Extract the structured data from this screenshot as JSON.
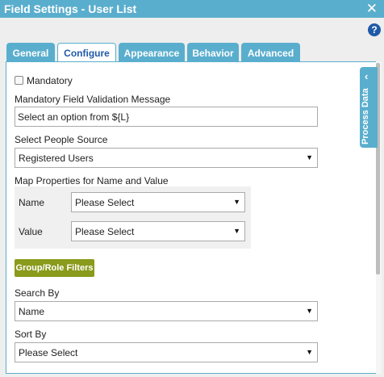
{
  "window": {
    "title": "Field Settings - User List",
    "close_glyph": "✕",
    "help_glyph": "?"
  },
  "tabs": [
    {
      "label": "General",
      "active": false
    },
    {
      "label": "Configure",
      "active": true
    },
    {
      "label": "Appearance",
      "active": false
    },
    {
      "label": "Behavior",
      "active": false
    },
    {
      "label": "Advanced",
      "active": false
    }
  ],
  "side_panel": {
    "label": "Process Data",
    "chevron": "‹"
  },
  "form": {
    "mandatory_label": "Mandatory",
    "mandatory_checked": false,
    "validation_label": "Mandatory Field Validation Message",
    "validation_value": "Select an option from ${L}",
    "people_source_label": "Select People Source",
    "people_source_value": "Registered Users",
    "map_label": "Map Properties for Name and Value",
    "name_label": "Name",
    "name_value": "Please Select",
    "value_label": "Value",
    "value_value": "Please Select",
    "group_button": "Group/Role Filters",
    "search_by_label": "Search By",
    "search_by_value": "Name",
    "sort_by_label": "Sort By",
    "sort_by_value": "Please Select"
  },
  "icons": {
    "dropdown_arrow": "▼",
    "close": "close-icon",
    "help": "help-icon",
    "chevron": "chevron-left-icon"
  },
  "colors": {
    "accent": "#5aaecd",
    "tab_active_text": "#1f5aa8",
    "button_olive": "#8a9a1b",
    "help_blue": "#1f5aa8"
  }
}
